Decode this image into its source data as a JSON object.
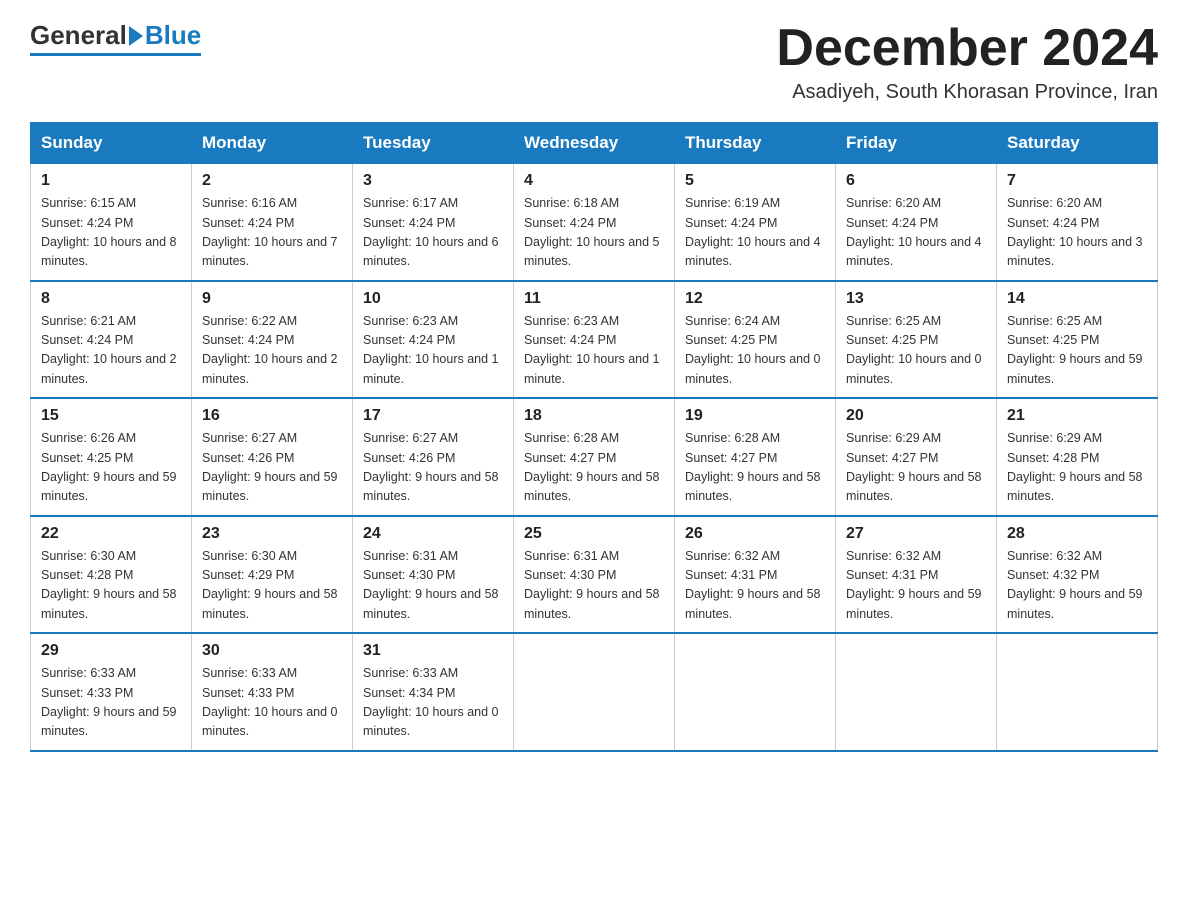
{
  "header": {
    "logo_general": "General",
    "logo_blue": "Blue",
    "month_year": "December 2024",
    "location": "Asadiyeh, South Khorasan Province, Iran"
  },
  "days_of_week": [
    "Sunday",
    "Monday",
    "Tuesday",
    "Wednesday",
    "Thursday",
    "Friday",
    "Saturday"
  ],
  "weeks": [
    [
      {
        "day": "1",
        "sunrise": "6:15 AM",
        "sunset": "4:24 PM",
        "daylight": "10 hours and 8 minutes."
      },
      {
        "day": "2",
        "sunrise": "6:16 AM",
        "sunset": "4:24 PM",
        "daylight": "10 hours and 7 minutes."
      },
      {
        "day": "3",
        "sunrise": "6:17 AM",
        "sunset": "4:24 PM",
        "daylight": "10 hours and 6 minutes."
      },
      {
        "day": "4",
        "sunrise": "6:18 AM",
        "sunset": "4:24 PM",
        "daylight": "10 hours and 5 minutes."
      },
      {
        "day": "5",
        "sunrise": "6:19 AM",
        "sunset": "4:24 PM",
        "daylight": "10 hours and 4 minutes."
      },
      {
        "day": "6",
        "sunrise": "6:20 AM",
        "sunset": "4:24 PM",
        "daylight": "10 hours and 4 minutes."
      },
      {
        "day": "7",
        "sunrise": "6:20 AM",
        "sunset": "4:24 PM",
        "daylight": "10 hours and 3 minutes."
      }
    ],
    [
      {
        "day": "8",
        "sunrise": "6:21 AM",
        "sunset": "4:24 PM",
        "daylight": "10 hours and 2 minutes."
      },
      {
        "day": "9",
        "sunrise": "6:22 AM",
        "sunset": "4:24 PM",
        "daylight": "10 hours and 2 minutes."
      },
      {
        "day": "10",
        "sunrise": "6:23 AM",
        "sunset": "4:24 PM",
        "daylight": "10 hours and 1 minute."
      },
      {
        "day": "11",
        "sunrise": "6:23 AM",
        "sunset": "4:24 PM",
        "daylight": "10 hours and 1 minute."
      },
      {
        "day": "12",
        "sunrise": "6:24 AM",
        "sunset": "4:25 PM",
        "daylight": "10 hours and 0 minutes."
      },
      {
        "day": "13",
        "sunrise": "6:25 AM",
        "sunset": "4:25 PM",
        "daylight": "10 hours and 0 minutes."
      },
      {
        "day": "14",
        "sunrise": "6:25 AM",
        "sunset": "4:25 PM",
        "daylight": "9 hours and 59 minutes."
      }
    ],
    [
      {
        "day": "15",
        "sunrise": "6:26 AM",
        "sunset": "4:25 PM",
        "daylight": "9 hours and 59 minutes."
      },
      {
        "day": "16",
        "sunrise": "6:27 AM",
        "sunset": "4:26 PM",
        "daylight": "9 hours and 59 minutes."
      },
      {
        "day": "17",
        "sunrise": "6:27 AM",
        "sunset": "4:26 PM",
        "daylight": "9 hours and 58 minutes."
      },
      {
        "day": "18",
        "sunrise": "6:28 AM",
        "sunset": "4:27 PM",
        "daylight": "9 hours and 58 minutes."
      },
      {
        "day": "19",
        "sunrise": "6:28 AM",
        "sunset": "4:27 PM",
        "daylight": "9 hours and 58 minutes."
      },
      {
        "day": "20",
        "sunrise": "6:29 AM",
        "sunset": "4:27 PM",
        "daylight": "9 hours and 58 minutes."
      },
      {
        "day": "21",
        "sunrise": "6:29 AM",
        "sunset": "4:28 PM",
        "daylight": "9 hours and 58 minutes."
      }
    ],
    [
      {
        "day": "22",
        "sunrise": "6:30 AM",
        "sunset": "4:28 PM",
        "daylight": "9 hours and 58 minutes."
      },
      {
        "day": "23",
        "sunrise": "6:30 AM",
        "sunset": "4:29 PM",
        "daylight": "9 hours and 58 minutes."
      },
      {
        "day": "24",
        "sunrise": "6:31 AM",
        "sunset": "4:30 PM",
        "daylight": "9 hours and 58 minutes."
      },
      {
        "day": "25",
        "sunrise": "6:31 AM",
        "sunset": "4:30 PM",
        "daylight": "9 hours and 58 minutes."
      },
      {
        "day": "26",
        "sunrise": "6:32 AM",
        "sunset": "4:31 PM",
        "daylight": "9 hours and 58 minutes."
      },
      {
        "day": "27",
        "sunrise": "6:32 AM",
        "sunset": "4:31 PM",
        "daylight": "9 hours and 59 minutes."
      },
      {
        "day": "28",
        "sunrise": "6:32 AM",
        "sunset": "4:32 PM",
        "daylight": "9 hours and 59 minutes."
      }
    ],
    [
      {
        "day": "29",
        "sunrise": "6:33 AM",
        "sunset": "4:33 PM",
        "daylight": "9 hours and 59 minutes."
      },
      {
        "day": "30",
        "sunrise": "6:33 AM",
        "sunset": "4:33 PM",
        "daylight": "10 hours and 0 minutes."
      },
      {
        "day": "31",
        "sunrise": "6:33 AM",
        "sunset": "4:34 PM",
        "daylight": "10 hours and 0 minutes."
      },
      null,
      null,
      null,
      null
    ]
  ],
  "labels": {
    "sunrise": "Sunrise:",
    "sunset": "Sunset:",
    "daylight": "Daylight:"
  }
}
